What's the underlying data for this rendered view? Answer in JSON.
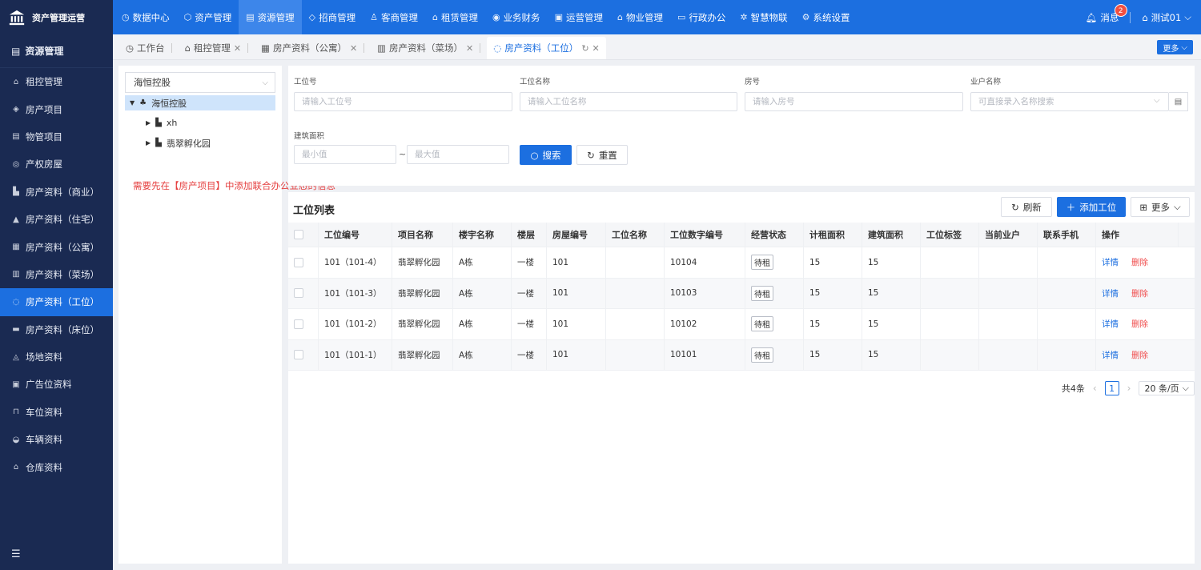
{
  "app": {
    "title": "资产管理运营"
  },
  "topnav": [
    {
      "icon": "◷",
      "label": "数据中心",
      "active": false
    },
    {
      "icon": "⬡",
      "label": "资产管理",
      "active": false
    },
    {
      "icon": "▤",
      "label": "资源管理",
      "active": true
    },
    {
      "icon": "◇",
      "label": "招商管理",
      "active": false
    },
    {
      "icon": "♙",
      "label": "客商管理",
      "active": false
    },
    {
      "icon": "⌂",
      "label": "租赁管理",
      "active": false
    },
    {
      "icon": "◉",
      "label": "业务财务",
      "active": false
    },
    {
      "icon": "▣",
      "label": "运营管理",
      "active": false
    },
    {
      "icon": "⌂",
      "label": "物业管理",
      "active": false
    },
    {
      "icon": "▭",
      "label": "行政办公",
      "active": false
    },
    {
      "icon": "✲",
      "label": "智慧物联",
      "active": false
    },
    {
      "icon": "⚙",
      "label": "系统设置",
      "active": false
    }
  ],
  "header": {
    "message_label": "消息",
    "message_count": "2",
    "user_label": "测试01"
  },
  "sidebar": {
    "title": "资源管理",
    "items": [
      {
        "icon": "⌂",
        "label": "租控管理",
        "active": false
      },
      {
        "icon": "◈",
        "label": "房产项目",
        "active": false
      },
      {
        "icon": "▤",
        "label": "物管项目",
        "active": false
      },
      {
        "icon": "◎",
        "label": "产权房屋",
        "active": false
      },
      {
        "icon": "▙",
        "label": "房产资料（商业）",
        "active": false
      },
      {
        "icon": "▲",
        "label": "房产资料（住宅）",
        "active": false
      },
      {
        "icon": "▦",
        "label": "房产资料（公寓）",
        "active": false
      },
      {
        "icon": "▥",
        "label": "房产资料（菜场）",
        "active": false
      },
      {
        "icon": "◌",
        "label": "房产资料（工位）",
        "active": true
      },
      {
        "icon": "▬",
        "label": "房产资料（床位）",
        "active": false
      },
      {
        "icon": "◬",
        "label": "场地资料",
        "active": false
      },
      {
        "icon": "▣",
        "label": "广告位资料",
        "active": false
      },
      {
        "icon": "⊓",
        "label": "车位资料",
        "active": false
      },
      {
        "icon": "◒",
        "label": "车辆资料",
        "active": false
      },
      {
        "icon": "⌂",
        "label": "仓库资料",
        "active": false
      }
    ]
  },
  "tabs": [
    {
      "icon": "◷",
      "label": "工作台",
      "closable": false,
      "active": false
    },
    {
      "icon": "⌂",
      "label": "租控管理",
      "closable": true,
      "active": false
    },
    {
      "icon": "▦",
      "label": "房产资料（公寓）",
      "closable": true,
      "active": false
    },
    {
      "icon": "▥",
      "label": "房产资料（菜场）",
      "closable": true,
      "active": false
    },
    {
      "icon": "◌",
      "label": "房产资料（工位）",
      "closable": true,
      "active": true
    }
  ],
  "tabs_more_label": "更多",
  "tree": {
    "selected": "海恒控股",
    "root": "海恒控股",
    "children": [
      "xh",
      "翡翠孵化园"
    ]
  },
  "note": "需要先在【房产项目】中添加联合办公业态的信息",
  "search": {
    "workstation_no_label": "工位号",
    "workstation_no_placeholder": "请输入工位号",
    "workstation_name_label": "工位名称",
    "workstation_name_placeholder": "请输入工位名称",
    "room_no_label": "房号",
    "room_no_placeholder": "请输入房号",
    "tenant_label": "业户名称",
    "tenant_placeholder": "可直接录入名称搜索",
    "area_label": "建筑面积",
    "area_min_placeholder": "最小值",
    "area_max_placeholder": "最大值",
    "area_separator": "~",
    "search_label": "搜索",
    "reset_label": "重置"
  },
  "list": {
    "title": "工位列表",
    "refresh_label": "刷新",
    "add_label": "添加工位",
    "more_label": "更多",
    "columns": [
      "工位编号",
      "项目名称",
      "楼宇名称",
      "楼层",
      "房屋编号",
      "工位名称",
      "工位数字编号",
      "经营状态",
      "计租面积",
      "建筑面积",
      "工位标签",
      "当前业户",
      "联系手机",
      "操作"
    ],
    "rows": [
      {
        "code": "101（101-4）",
        "project": "翡翠孵化园",
        "building": "A栋",
        "floor": "一楼",
        "room": "101",
        "name": "",
        "num": "10104",
        "status": "待租",
        "rent_area": "15",
        "build_area": "15",
        "tag": "",
        "tenant": "",
        "phone": ""
      },
      {
        "code": "101（101-3）",
        "project": "翡翠孵化园",
        "building": "A栋",
        "floor": "一楼",
        "room": "101",
        "name": "",
        "num": "10103",
        "status": "待租",
        "rent_area": "15",
        "build_area": "15",
        "tag": "",
        "tenant": "",
        "phone": ""
      },
      {
        "code": "101（101-2）",
        "project": "翡翠孵化园",
        "building": "A栋",
        "floor": "一楼",
        "room": "101",
        "name": "",
        "num": "10102",
        "status": "待租",
        "rent_area": "15",
        "build_area": "15",
        "tag": "",
        "tenant": "",
        "phone": ""
      },
      {
        "code": "101（101-1）",
        "project": "翡翠孵化园",
        "building": "A栋",
        "floor": "一楼",
        "room": "101",
        "name": "",
        "num": "10101",
        "status": "待租",
        "rent_area": "15",
        "build_area": "15",
        "tag": "",
        "tenant": "",
        "phone": ""
      }
    ],
    "detail_label": "详情",
    "delete_label": "删除",
    "total_label": "共4条",
    "current_page": "1",
    "page_size_label": "20 条/页"
  },
  "colors": {
    "primary": "#1c6fe0",
    "sidebar": "#1a2a52",
    "danger": "#f04d4d",
    "note": "#e53f3f"
  }
}
